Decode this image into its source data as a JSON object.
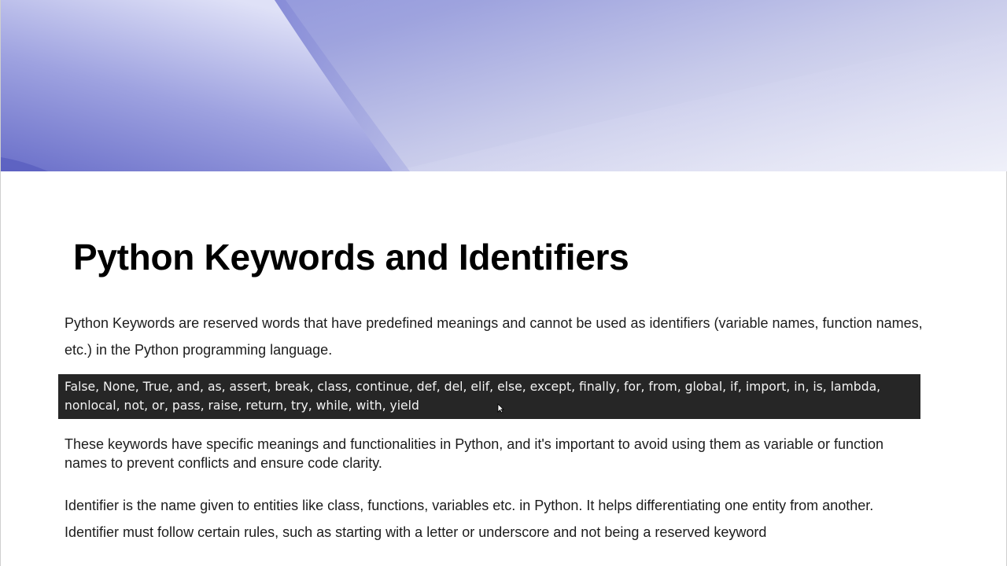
{
  "slide": {
    "title": "Python Keywords and Identifiers",
    "paragraph_1": "Python Keywords are reserved words that have predefined meanings and cannot be used as identifiers (variable names, function names, etc.) in the Python programming language.",
    "keywords_list": "False, None, True, and, as, assert, break, class, continue, def, del, elif, else, except, finally, for, from, global, if, import, in, is, lambda, nonlocal, not, or, pass, raise, return, try, while, with, yield",
    "paragraph_2": "These keywords have specific meanings and functionalities in Python, and it's important to avoid using them as variable or function names to prevent conflicts and ensure code clarity.",
    "paragraph_3": "Identifier is the name given to entities like class, functions, variables etc. in Python. It helps differentiating one entity from another. Identifier must follow certain rules, such as starting with a letter or underscore and not being a reserved keyword"
  },
  "colors": {
    "banner_primary": "#6f74cf",
    "banner_light": "#e6e8f8",
    "code_box_background": "#262626",
    "code_box_text": "#f4f4f4",
    "title_text": "#000000",
    "body_text": "#1c1c1c"
  },
  "icons": {
    "cursor": "mouse-cursor-icon"
  }
}
